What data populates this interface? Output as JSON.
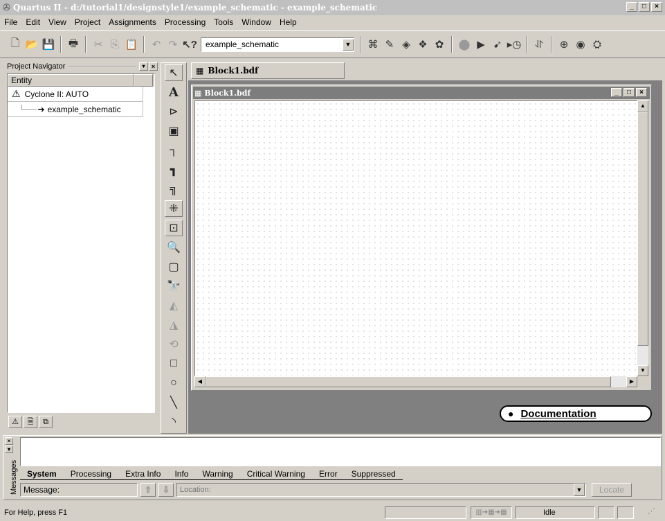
{
  "window": {
    "title": "Quartus II - d:/tutorial1/designstyle1/example_schematic - example_schematic"
  },
  "menu": [
    "File",
    "Edit",
    "View",
    "Project",
    "Assignments",
    "Processing",
    "Tools",
    "Window",
    "Help"
  ],
  "toolbar": {
    "combo_value": "example_schematic"
  },
  "navigator": {
    "title": "Project Navigator",
    "column_header": "Entity",
    "items": [
      {
        "label": "Cyclone II: AUTO"
      },
      {
        "label": "example_schematic"
      }
    ]
  },
  "editor": {
    "tab_label": "Block1.bdf",
    "doc_title": "Block1.bdf"
  },
  "documentation_label": "Documentation",
  "messages": {
    "side_label": "Messages",
    "tabs": [
      "System",
      "Processing",
      "Extra Info",
      "Info",
      "Warning",
      "Critical Warning",
      "Error",
      "Suppressed"
    ],
    "message_label": "Message:",
    "location_placeholder": "Location:",
    "locate_button": "Locate"
  },
  "status": {
    "help_text": "For Help, press F1",
    "state": "Idle"
  },
  "colors": {
    "title_inactive": "#c0c0c0",
    "title_active": "#7d7d7d",
    "face": "#d4d0c8",
    "mdi_background": "#808080"
  }
}
